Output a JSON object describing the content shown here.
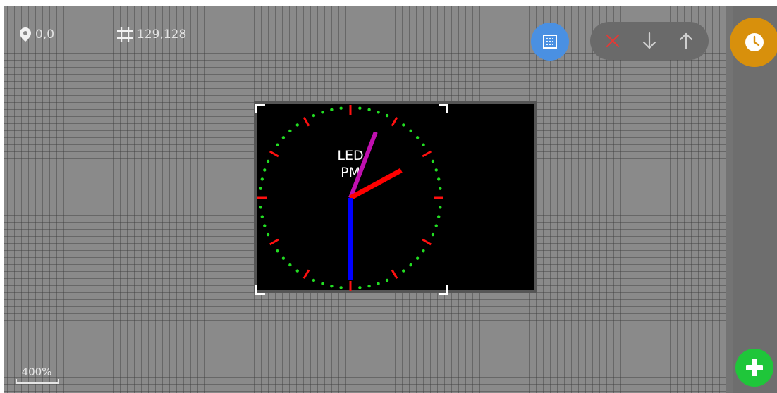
{
  "status": {
    "position_icon": "location-pin-icon",
    "position_text": "0,0",
    "size_icon": "crop-icon",
    "size_text": "129,128"
  },
  "zoom": {
    "label": "400%"
  },
  "toolbar": {
    "grid_icon": "grid-dots-icon",
    "delete_icon": "close-icon",
    "move_down_icon": "arrow-down-icon",
    "move_up_icon": "arrow-up-icon",
    "clock_icon": "clock-icon",
    "add_icon": "plus-icon"
  },
  "clock_face": {
    "label_line1": "LED",
    "label_line2": "PM",
    "dot_color": "#22dd22",
    "tick_color": "#ff1010",
    "hour_hand_color": "#ff0000",
    "minute_hand_color": "#c010b0",
    "second_hand_color": "#0000ff",
    "time_shown": "2:03:30"
  },
  "colors": {
    "grid_button": "#4a90e2",
    "clock_button": "#d8900c",
    "add_button": "#1fc63a",
    "delete_icon": "#e53935"
  }
}
